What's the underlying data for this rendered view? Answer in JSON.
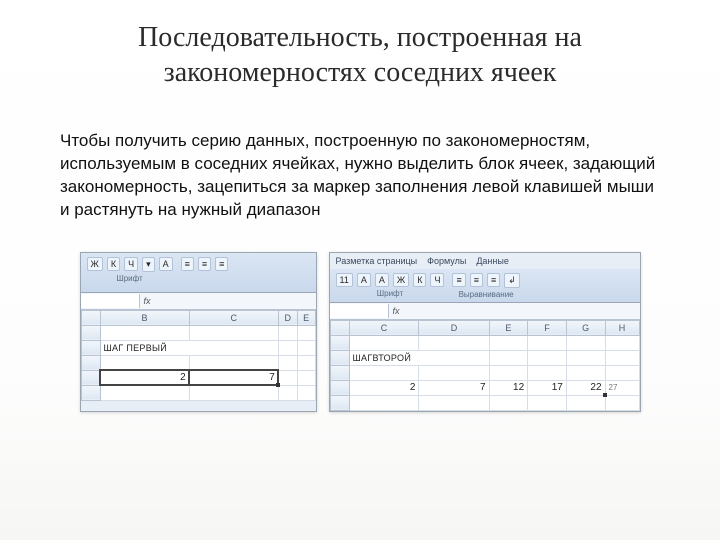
{
  "title_line1": "Последовательность, построенная на",
  "title_line2": "закономерностях соседних ячеек",
  "paragraph": "Чтобы получить серию данных, построенную по закономерностям, используемым в соседних ячейках, нужно выделить блок ячеек, задающий закономерность, зацепиться за маркер заполнения левой клавишей мыши и растянуть на нужный диапазон",
  "left": {
    "ribbon_group": "Шрифт",
    "ribbon_bits": [
      "Ж",
      "К",
      "Ч",
      "▾",
      "A",
      "≡",
      "≡",
      "≡"
    ],
    "fx": "fx",
    "cols": [
      "",
      "B",
      "C",
      "D",
      "E"
    ],
    "step_label": "ШАГ ПЕРВЫЙ",
    "vals": [
      "2",
      "7"
    ]
  },
  "right": {
    "tabs": [
      "Разметка страницы",
      "Формулы",
      "Данные"
    ],
    "font_size": "11",
    "ribbon_bits": [
      "Ж",
      "К",
      "Ч",
      "▾",
      "A",
      "A"
    ],
    "ribbon_group1": "Шрифт",
    "ribbon_group2": "Выравнивание",
    "fx": "fx",
    "cols": [
      "",
      "C",
      "D",
      "E",
      "F",
      "G",
      "H"
    ],
    "step_label": "ШАГВТОРОЙ",
    "vals": [
      "2",
      "7",
      "12",
      "17",
      "22"
    ],
    "hint": "27"
  }
}
